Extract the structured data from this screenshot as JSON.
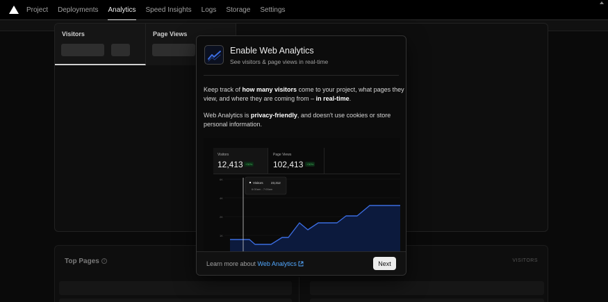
{
  "nav": {
    "items": [
      {
        "label": "Project",
        "active": false
      },
      {
        "label": "Deployments",
        "active": false
      },
      {
        "label": "Analytics",
        "active": true
      },
      {
        "label": "Speed Insights",
        "active": false
      },
      {
        "label": "Logs",
        "active": false
      },
      {
        "label": "Storage",
        "active": false
      },
      {
        "label": "Settings",
        "active": false
      }
    ]
  },
  "metrics": {
    "visitors_label": "Visitors",
    "page_views_label": "Page Views"
  },
  "top_pages": {
    "title": "Top Pages",
    "info_icon": "i",
    "column_label": "VISITORS"
  },
  "modal": {
    "title": "Enable Web Analytics",
    "subtitle": "See visitors & page views in real-time",
    "para1": {
      "t1": "Keep track of ",
      "b1": "how many visitors",
      "t2": " come to your project, what pages they view, and where they are coming from – ",
      "b2": "in real-time",
      "t3": "."
    },
    "para2": {
      "t1": "Web Analytics is ",
      "b1": "privacy-friendly",
      "t2": ", and doesn't use cookies or store personal information."
    },
    "preview": {
      "visitors_label": "Visitors",
      "visitors_value": "12,413",
      "visitors_badge": "+30%",
      "page_views_label": "Page Views",
      "page_views_value": "102,413",
      "page_views_badge": "+30%",
      "y_ticks": [
        "6K",
        "4K",
        "2K",
        "1K"
      ],
      "tooltip_label": "Visitors",
      "tooltip_value": "23,312",
      "tooltip_time": "6:00am - 7:00am"
    },
    "footer": {
      "learn_text": "Learn more about ",
      "learn_link": "Web Analytics",
      "next_label": "Next"
    }
  },
  "colors": {
    "accent_link": "#52a8ff",
    "chart_line": "#3b6ce0",
    "badge_green": "#3fbf5a"
  }
}
